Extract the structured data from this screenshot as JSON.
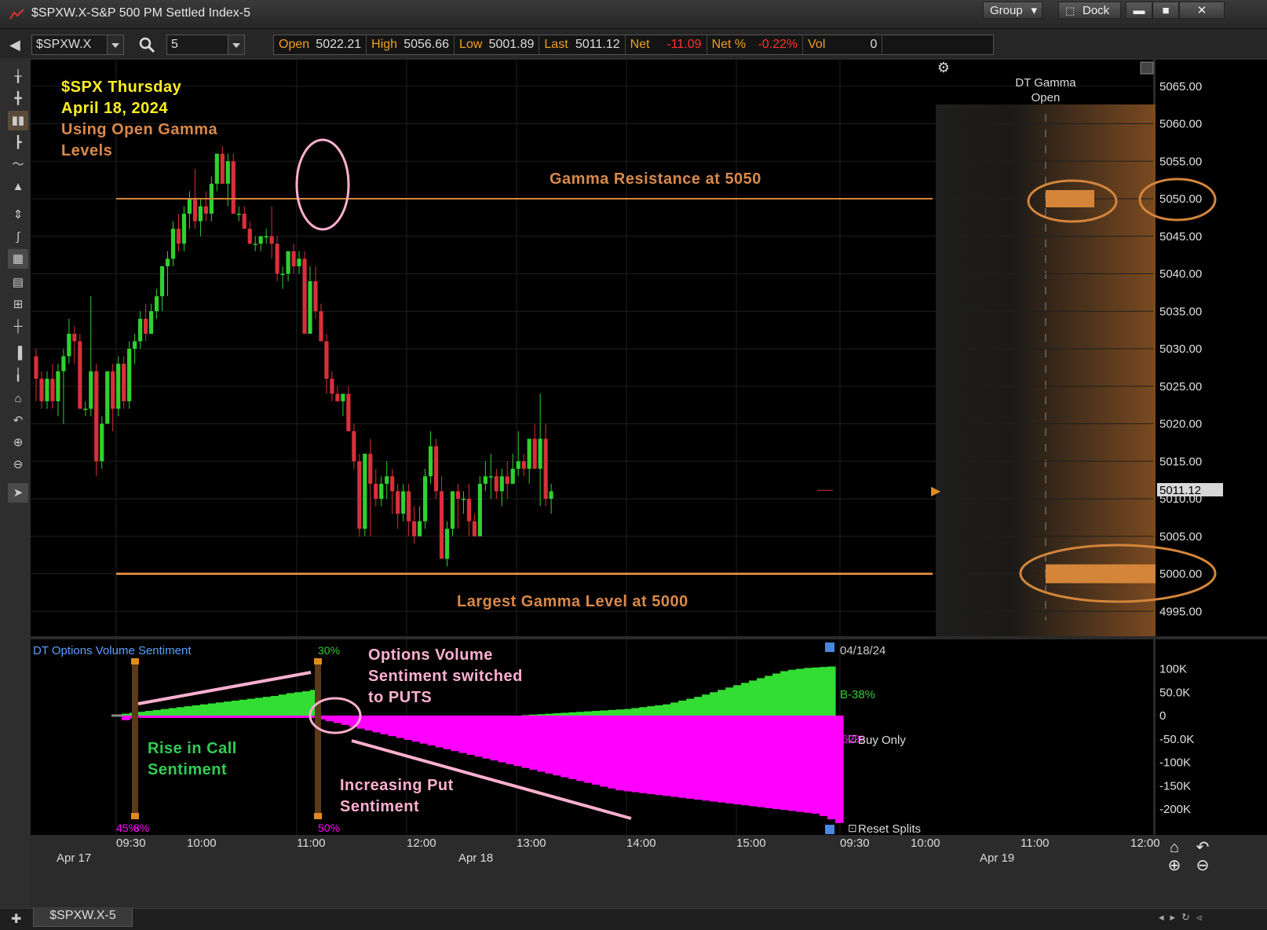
{
  "window": {
    "title": "$SPXW.X-S&P 500 PM Settled Index-5",
    "group_label": "Group",
    "dock_label": "Dock"
  },
  "toolbar": {
    "symbol": "$SPXW.X",
    "interval": "5",
    "quote": [
      {
        "label": "Open",
        "value": "5022.21",
        "neg": false
      },
      {
        "label": "High",
        "value": "5056.66",
        "neg": false
      },
      {
        "label": "Low",
        "value": "5001.89",
        "neg": false
      },
      {
        "label": "Last",
        "value": "5011.12",
        "neg": false
      },
      {
        "label": "Net",
        "value": "-11.09",
        "neg": true
      },
      {
        "label": "Net %",
        "value": "-0.22%",
        "neg": true
      },
      {
        "label": "Vol",
        "value": "0",
        "neg": false
      }
    ]
  },
  "annotations": {
    "heading_line1": "$SPX Thursday",
    "heading_line2": "April 18, 2024",
    "sub_line1": "Using Open Gamma",
    "sub_line2": "Levels",
    "resistance": "Gamma Resistance at 5050",
    "largest": "Largest Gamma Level at 5000",
    "dt_gamma_line1": "DT Gamma",
    "dt_gamma_line2": "Open",
    "switch_line1": "Options Volume",
    "switch_line2": "Sentiment switched",
    "switch_line3": "to PUTS",
    "rise_line1": "Rise in Call",
    "rise_line2": "Sentiment",
    "put_line1": "Increasing Put",
    "put_line2": "Sentiment"
  },
  "indicator": {
    "name": "DT Options Volume Sentiment",
    "date_label": "04/18/24",
    "b_label": "B-38%",
    "buy_only_label": "Buy Only",
    "reset_label": "Reset Splits",
    "pct_30": "30%",
    "pct_45": "45%",
    "pct_8": "8%",
    "pct_50": "50%",
    "pct_hidden": "62%",
    "y_ticks": [
      "100K",
      "50.0K",
      "0",
      "-50.0K",
      "-100K",
      "-150K",
      "-200K"
    ]
  },
  "last_price_tag": "5011.12",
  "time_axis": {
    "times": [
      "09:30",
      "10:00",
      "11:00",
      "12:00",
      "13:00",
      "14:00",
      "15:00",
      "09:30",
      "10:00",
      "11:00",
      "12:00"
    ],
    "dates": [
      "Apr 17",
      "Apr 18",
      "Apr 19"
    ]
  },
  "tab": {
    "label": "$SPXW.X-5"
  },
  "colors": {
    "up": "#2fd12f",
    "down": "#d8303a",
    "gamma": "#d4853a",
    "call": "#33dd33",
    "put": "#ff00ff",
    "annotation_yellow": "#ffee22",
    "annotation_orange": "#d8894a",
    "annotation_pink": "#ffb0d0",
    "annotation_green": "#33cc55"
  },
  "chart_data": [
    {
      "type": "candlestick",
      "title": "$SPXW.X-S&P 500 PM Settled Index-5",
      "ylim": [
        4992,
        5068
      ],
      "y_ticks": [
        4995,
        5000,
        5005,
        5010,
        5015,
        5020,
        5025,
        5030,
        5035,
        5040,
        5045,
        5050,
        5055,
        5060,
        5065
      ],
      "reference_lines": [
        {
          "value": 5050,
          "label": "Gamma Resistance at 5050"
        },
        {
          "value": 5000,
          "label": "Largest Gamma Level at 5000"
        }
      ],
      "last": 5011.12,
      "candles": [
        [
          5029,
          5030,
          5023,
          5026
        ],
        [
          5026,
          5027,
          5022,
          5023
        ],
        [
          5023,
          5027,
          5022,
          5026
        ],
        [
          5026,
          5028,
          5022,
          5023
        ],
        [
          5023,
          5028,
          5021,
          5027
        ],
        [
          5027,
          5030,
          5020,
          5029
        ],
        [
          5029,
          5034,
          5028,
          5032
        ],
        [
          5032,
          5033,
          5028,
          5031
        ],
        [
          5031,
          5032,
          5022,
          5022
        ],
        [
          5022,
          5023,
          5021,
          5022
        ],
        [
          5022,
          5037,
          5021,
          5027
        ],
        [
          5027,
          5028,
          5013,
          5015
        ],
        [
          5015,
          5021,
          5014,
          5020
        ],
        [
          5020,
          5027,
          5020,
          5027
        ],
        [
          5027,
          5028,
          5019,
          5022
        ],
        [
          5022,
          5029,
          5021,
          5028
        ],
        [
          5028,
          5029,
          5022,
          5023
        ],
        [
          5023,
          5031,
          5022,
          5030
        ],
        [
          5030,
          5032,
          5028,
          5031
        ],
        [
          5031,
          5035,
          5030,
          5034
        ],
        [
          5034,
          5036,
          5031,
          5032
        ],
        [
          5032,
          5036,
          5032,
          5035
        ],
        [
          5035,
          5038,
          5034,
          5037
        ],
        [
          5037,
          5041,
          5035,
          5041
        ],
        [
          5041,
          5043,
          5037,
          5042
        ],
        [
          5042,
          5047,
          5041,
          5046
        ],
        [
          5046,
          5048,
          5043,
          5044
        ],
        [
          5044,
          5049,
          5043,
          5048
        ],
        [
          5048,
          5051,
          5046,
          5050
        ],
        [
          5050,
          5054,
          5046,
          5047
        ],
        [
          5047,
          5050,
          5045,
          5049
        ],
        [
          5049,
          5051,
          5047,
          5048
        ],
        [
          5048,
          5053,
          5047,
          5052
        ],
        [
          5052,
          5056,
          5051,
          5056
        ],
        [
          5056,
          5057,
          5052,
          5052
        ],
        [
          5052,
          5056,
          5049,
          5055
        ],
        [
          5055,
          5056,
          5048,
          5048
        ],
        [
          5048,
          5049,
          5047,
          5048
        ],
        [
          5048,
          5049,
          5046,
          5046
        ],
        [
          5046,
          5047,
          5044,
          5044
        ],
        [
          5044,
          5045,
          5043,
          5044
        ],
        [
          5044,
          5045,
          5043,
          5045
        ],
        [
          5045,
          5046,
          5044,
          5045
        ],
        [
          5045,
          5049,
          5042,
          5044
        ],
        [
          5044,
          5045,
          5039,
          5040
        ],
        [
          5040,
          5041,
          5038,
          5040
        ],
        [
          5040,
          5043,
          5039,
          5043
        ],
        [
          5043,
          5044,
          5040,
          5041
        ],
        [
          5041,
          5043,
          5040,
          5042
        ],
        [
          5042,
          5043,
          5032,
          5032
        ],
        [
          5032,
          5041,
          5032,
          5039
        ],
        [
          5039,
          5041,
          5034,
          5035
        ],
        [
          5035,
          5036,
          5031,
          5031
        ],
        [
          5031,
          5032,
          5024,
          5026
        ],
        [
          5026,
          5027,
          5023,
          5024
        ],
        [
          5024,
          5025,
          5023,
          5023
        ],
        [
          5023,
          5024,
          5021,
          5024
        ],
        [
          5024,
          5025,
          5019,
          5019
        ],
        [
          5019,
          5020,
          5014,
          5015
        ],
        [
          5015,
          5016,
          5005,
          5006
        ],
        [
          5006,
          5016,
          5005,
          5016
        ],
        [
          5016,
          5018,
          5005,
          5012
        ],
        [
          5012,
          5014,
          5009,
          5010
        ],
        [
          5010,
          5013,
          5009,
          5012
        ],
        [
          5012,
          5015,
          5010,
          5013
        ],
        [
          5013,
          5014,
          5008,
          5011
        ],
        [
          5011,
          5012,
          5006,
          5008
        ],
        [
          5008,
          5012,
          5007,
          5011
        ],
        [
          5011,
          5012,
          5005,
          5007
        ],
        [
          5007,
          5009,
          5004,
          5005
        ],
        [
          5005,
          5009,
          5005,
          5007
        ],
        [
          5007,
          5014,
          5006,
          5013
        ],
        [
          5013,
          5019,
          5012,
          5017
        ],
        [
          5017,
          5018,
          5010,
          5011
        ],
        [
          5011,
          5013,
          5005,
          5002
        ],
        [
          5002,
          5007,
          5001,
          5006
        ],
        [
          5006,
          5011,
          5005,
          5011
        ],
        [
          5011,
          5012,
          5006,
          5010
        ],
        [
          5010,
          5011,
          5008,
          5010
        ],
        [
          5010,
          5012,
          5005,
          5007
        ],
        [
          5007,
          5008,
          5005,
          5005
        ],
        [
          5005,
          5013,
          5005,
          5012
        ],
        [
          5012,
          5015,
          5011,
          5013
        ],
        [
          5013,
          5016,
          5010,
          5013
        ],
        [
          5013,
          5014,
          5010,
          5011
        ],
        [
          5011,
          5014,
          5009,
          5013
        ],
        [
          5013,
          5015,
          5010,
          5012
        ],
        [
          5012,
          5016,
          5012,
          5014
        ],
        [
          5014,
          5019,
          5013,
          5015
        ],
        [
          5015,
          5016,
          5013,
          5014
        ],
        [
          5014,
          5018,
          5012,
          5018
        ],
        [
          5018,
          5020,
          5014,
          5014
        ],
        [
          5014,
          5024,
          5009,
          5018
        ],
        [
          5018,
          5020,
          5009,
          5010
        ],
        [
          5010,
          5012,
          5008,
          5011
        ]
      ]
    },
    {
      "type": "area",
      "title": "DT Options Volume Sentiment",
      "ylim": [
        -250000,
        120000
      ],
      "y_ticks": [
        100000,
        50000,
        0,
        -50000,
        -100000,
        -150000,
        -200000
      ],
      "series": [
        {
          "name": "call",
          "values": [
            4000,
            6000,
            8000,
            10000,
            12000,
            14000,
            16000,
            18000,
            20000,
            22000,
            24000,
            26000,
            28000,
            30000,
            32000,
            34000,
            36000,
            38000,
            40000,
            42000,
            45000,
            48000,
            50000,
            52000,
            55000,
            0,
            0,
            0,
            0,
            0,
            0,
            0,
            0,
            0,
            0,
            0,
            0,
            0,
            0,
            0,
            0,
            0,
            0,
            0,
            0,
            0,
            0,
            0,
            0,
            0,
            0,
            1000,
            2000,
            3000,
            4000,
            5000,
            6000,
            7000,
            8000,
            9000,
            10000,
            11000,
            12000,
            13000,
            14000,
            16000,
            18000,
            20000,
            22000,
            24000,
            28000,
            32000,
            36000,
            40000,
            45000,
            50000,
            55000,
            60000,
            65000,
            70000,
            75000,
            80000,
            85000,
            90000,
            95000,
            98000,
            100000,
            102000,
            103000,
            104000,
            105000
          ]
        },
        {
          "name": "put",
          "values": [
            -10000,
            -6000,
            -5000,
            -5000,
            -5000,
            -5000,
            -5000,
            -5000,
            -5000,
            -5000,
            -5000,
            -5000,
            -5000,
            -5000,
            -5000,
            -5000,
            -5000,
            -5000,
            -5000,
            -5000,
            -5000,
            -5000,
            -5000,
            -5000,
            -5000,
            -8000,
            -12000,
            -16000,
            -20000,
            -24000,
            -28000,
            -32000,
            -36000,
            -40000,
            -44000,
            -48000,
            -52000,
            -56000,
            -60000,
            -64000,
            -68000,
            -72000,
            -76000,
            -80000,
            -84000,
            -88000,
            -92000,
            -96000,
            -100000,
            -104000,
            -108000,
            -112000,
            -116000,
            -120000,
            -124000,
            -128000,
            -132000,
            -136000,
            -140000,
            -144000,
            -148000,
            -152000,
            -156000,
            -160000,
            -162000,
            -164000,
            -166000,
            -168000,
            -170000,
            -172000,
            -174000,
            -176000,
            -178000,
            -180000,
            -182000,
            -184000,
            -186000,
            -188000,
            -190000,
            -192000,
            -194000,
            -196000,
            -198000,
            -200000,
            -202000,
            -204000,
            -206000,
            -208000,
            -210000,
            -215000,
            -222000,
            -230000
          ]
        }
      ]
    }
  ]
}
